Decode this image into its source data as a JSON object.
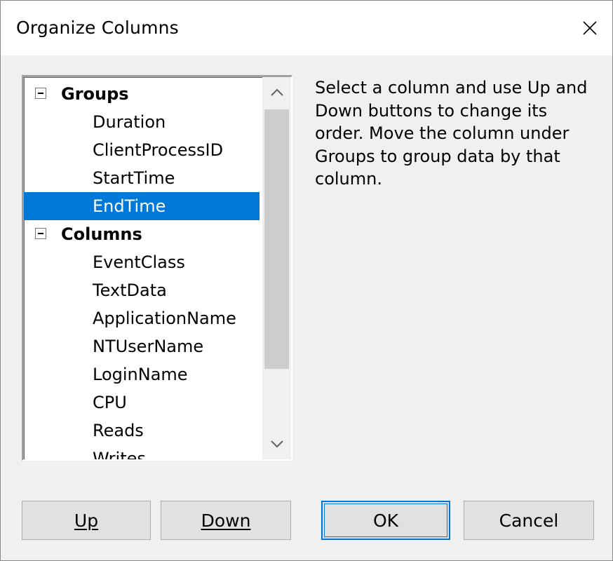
{
  "dialog": {
    "title": "Organize Columns",
    "close_icon": "close-icon"
  },
  "tree": {
    "groups_label": "Groups",
    "groups": [
      "Duration",
      "ClientProcessID",
      "StartTime",
      "EndTime"
    ],
    "selected": "EndTime",
    "columns_label": "Columns",
    "columns": [
      "EventClass",
      "TextData",
      "ApplicationName",
      "NTUserName",
      "LoginName",
      "CPU",
      "Reads",
      "Writes"
    ],
    "scroll_up_icon": "chevron-up-icon",
    "scroll_down_icon": "chevron-down-icon"
  },
  "help_text": "Select a column and use Up and Down buttons to change its order. Move the column under Groups to group data by that column.",
  "buttons": {
    "up": "Up",
    "down": "Down",
    "ok": "OK",
    "cancel": "Cancel"
  },
  "colors": {
    "selection": "#0078d7",
    "dialog_bg": "#f0f0f0",
    "button_bg": "#e1e1e1"
  }
}
